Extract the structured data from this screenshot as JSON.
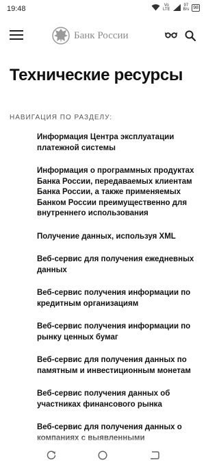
{
  "status": {
    "time": "19:48",
    "network_speed": "97",
    "network_unit": "B/s",
    "vo": "Vo",
    "lte": "LTE",
    "battery": "98"
  },
  "header": {
    "brand": "Банк России"
  },
  "page": {
    "title": "Технические ресурсы",
    "nav_label": "НАВИГАЦИЯ ПО РАЗДЕЛУ:",
    "items": [
      "Информация Центра эксплуатации платежной системы",
      "Информация о программных продуктах Банка России, передаваемых клиентам Банка России, а также применяемых Банком России преимущественно для внутреннего использования",
      "Получение данных, используя XML",
      "Веб-сервис для получения ежедневных данных",
      "Веб-сервис получения информации по кредитным организациям",
      "Веб-сервис получения информации по рынку ценных бумаг",
      "Веб-сервис для получения данных по памятным и инвестиционным монетам",
      "Веб-сервис получения данных об участниках финансового рынка",
      "Веб-сервис для получения данных о компаниях с выявленными"
    ]
  }
}
